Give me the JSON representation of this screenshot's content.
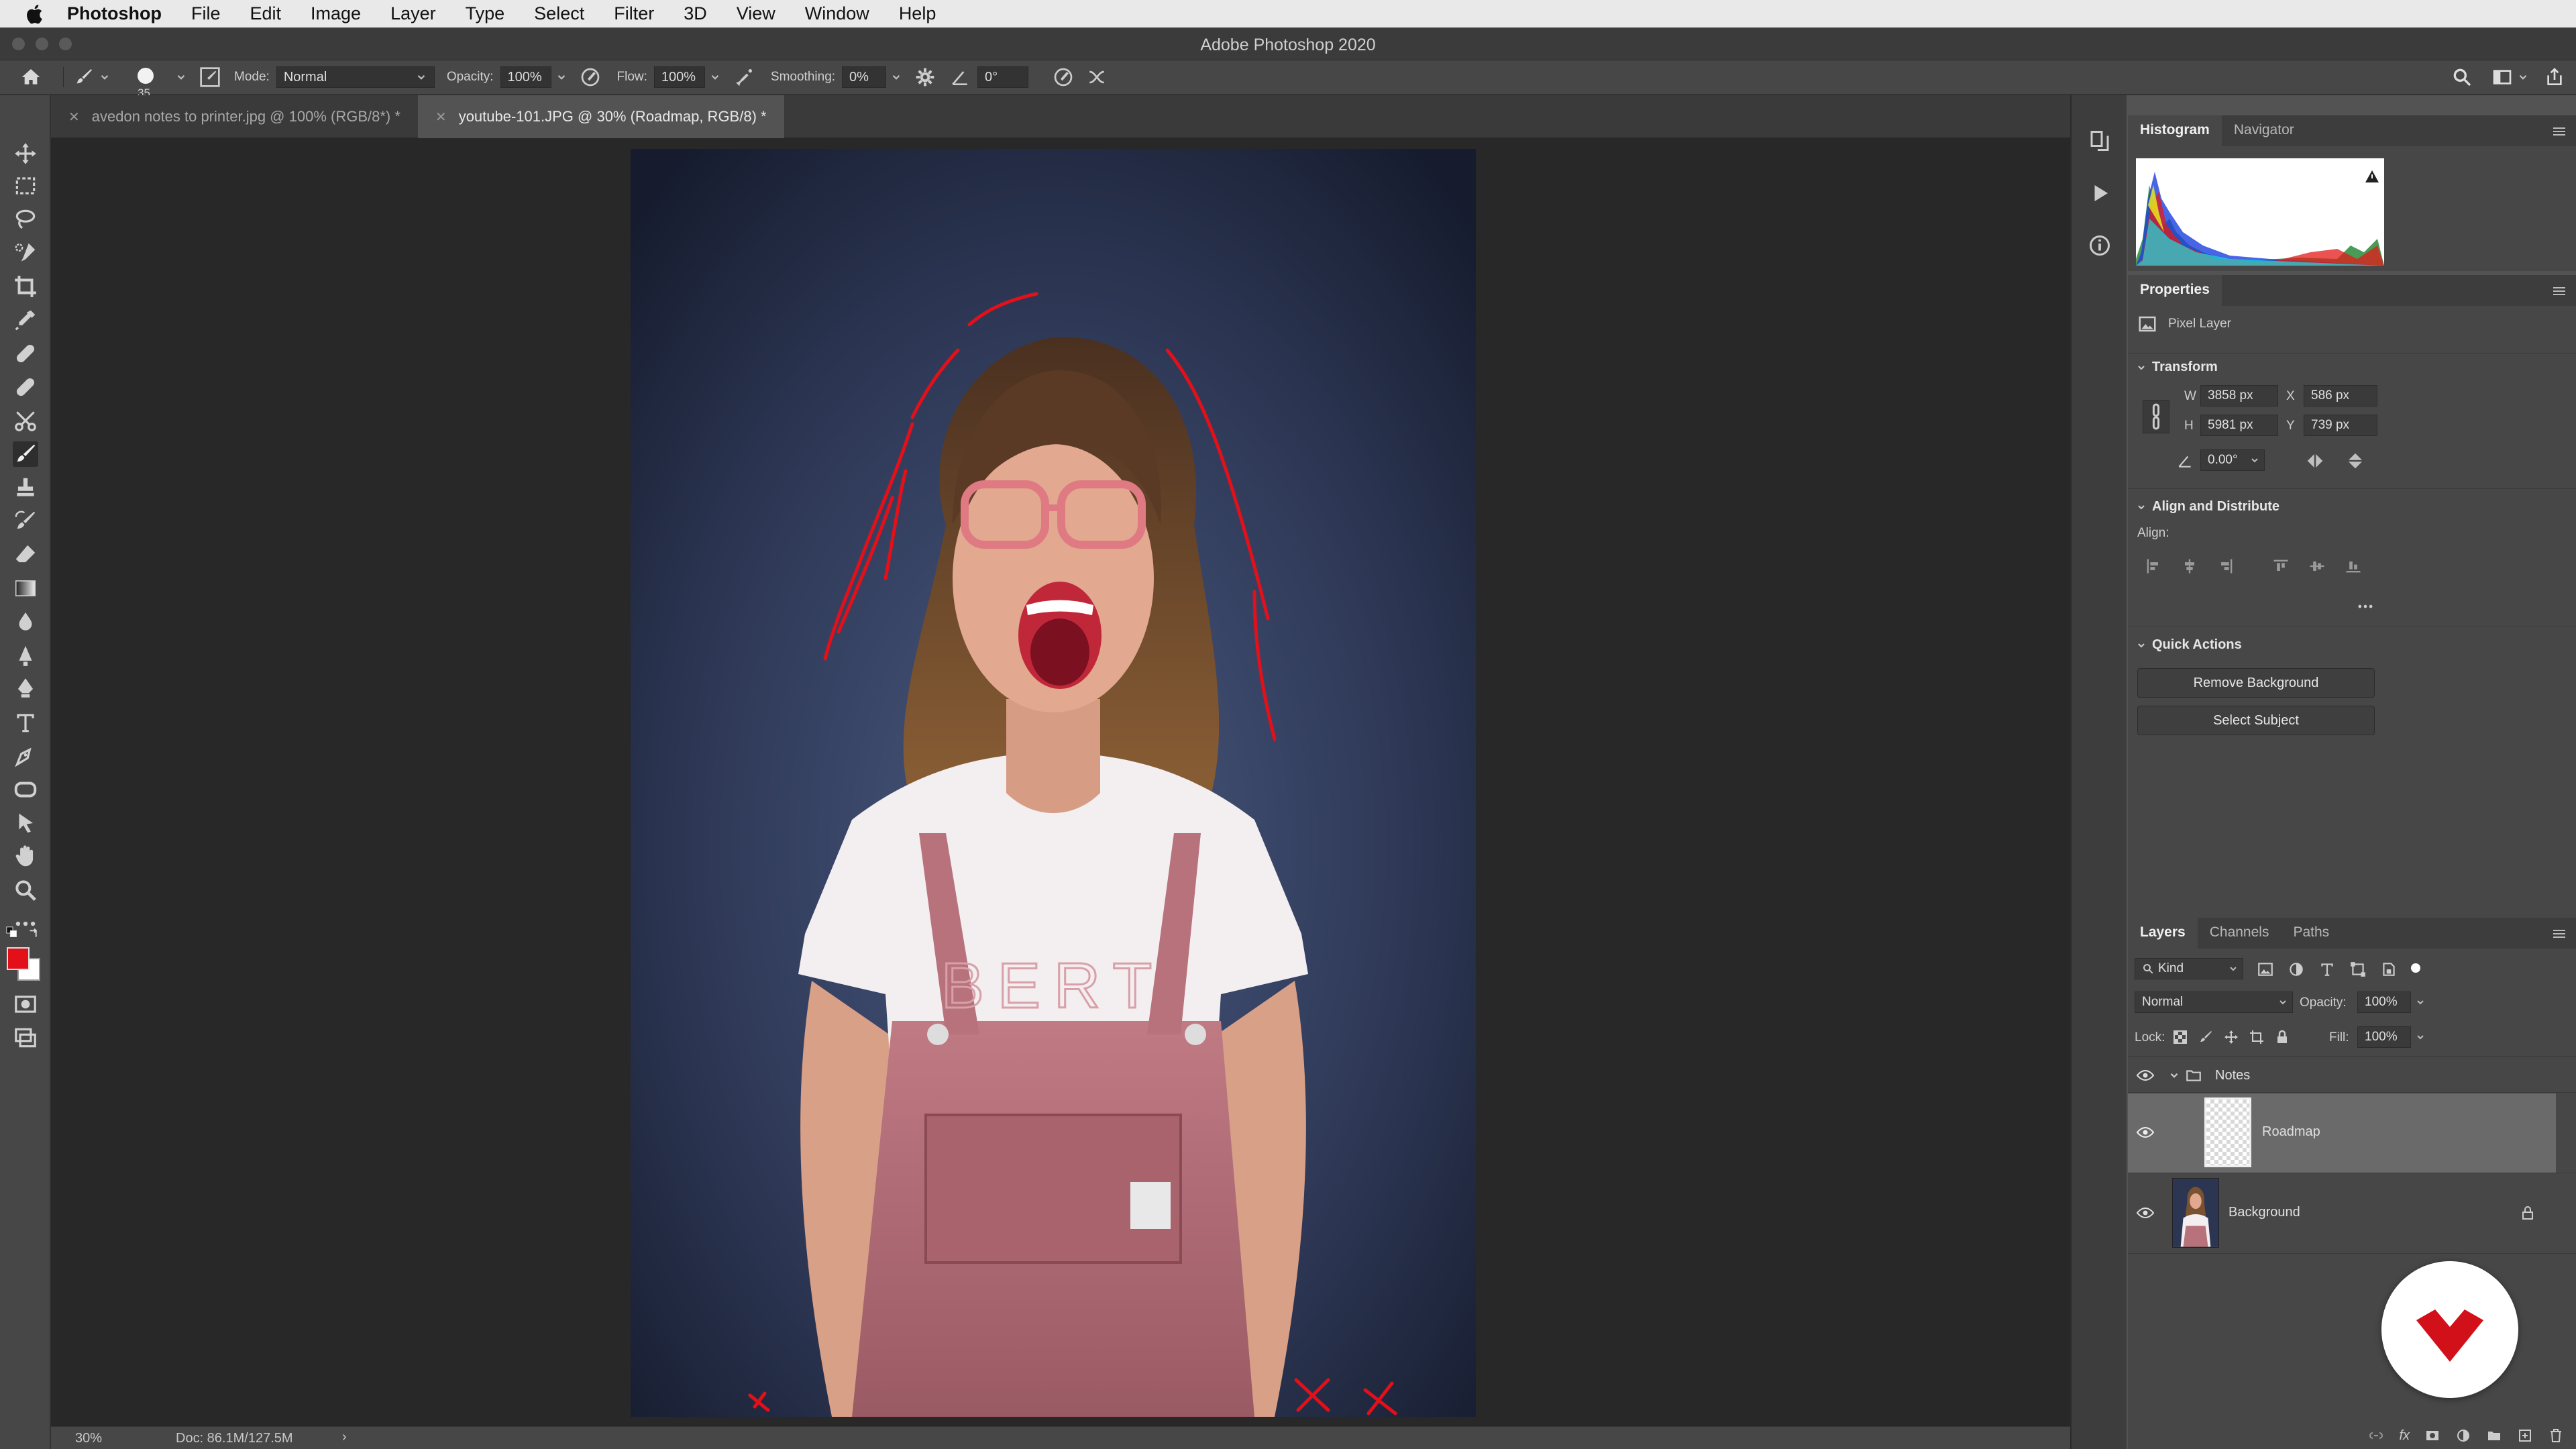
{
  "menubar": {
    "items": [
      "Photoshop",
      "File",
      "Edit",
      "Image",
      "Layer",
      "Type",
      "Select",
      "Filter",
      "3D",
      "View",
      "Window",
      "Help"
    ]
  },
  "window": {
    "title": "Adobe Photoshop 2020"
  },
  "options": {
    "brush_size": "35",
    "mode_label": "Mode:",
    "mode_value": "Normal",
    "opacity_label": "Opacity:",
    "opacity_value": "100%",
    "flow_label": "Flow:",
    "flow_value": "100%",
    "smoothing_label": "Smoothing:",
    "smoothing_value": "0%",
    "angle_value": "0°"
  },
  "tabs": [
    {
      "label": "avedon notes to printer.jpg @ 100% (RGB/8*) *",
      "active": false
    },
    {
      "label": "youtube-101.JPG @ 30% (Roadmap, RGB/8) *",
      "active": true
    }
  ],
  "status": {
    "zoom": "30%",
    "doc": "Doc: 86.1M/127.5M"
  },
  "colors": {
    "foreground": "#e3101a",
    "background": "#ffffff",
    "accent_red": "#e3101a"
  },
  "histogram_panel": {
    "tabs": [
      "Histogram",
      "Navigator"
    ]
  },
  "properties": {
    "title": "Properties",
    "layer_type": "Pixel Layer",
    "transform_label": "Transform",
    "w_label": "W",
    "w_value": "3858 px",
    "h_label": "H",
    "h_value": "5981 px",
    "x_label": "X",
    "x_value": "586 px",
    "y_label": "Y",
    "y_value": "739 px",
    "angle_value": "0.00°",
    "align_label": "Align and Distribute",
    "align_sub": "Align:",
    "quick_actions_label": "Quick Actions",
    "remove_bg": "Remove Background",
    "select_subject": "Select Subject"
  },
  "layers_panel": {
    "tabs": [
      "Layers",
      "Channels",
      "Paths"
    ],
    "filter_kind": "Kind",
    "blend_mode": "Normal",
    "opacity_label": "Opacity:",
    "opacity_value": "100%",
    "lock_label": "Lock:",
    "fill_label": "Fill:",
    "fill_value": "100%",
    "layers": [
      {
        "name": "Notes",
        "type": "group"
      },
      {
        "name": "Roadmap",
        "type": "pixel",
        "selected": true
      },
      {
        "name": "Background",
        "type": "pixel",
        "locked": true
      }
    ]
  }
}
